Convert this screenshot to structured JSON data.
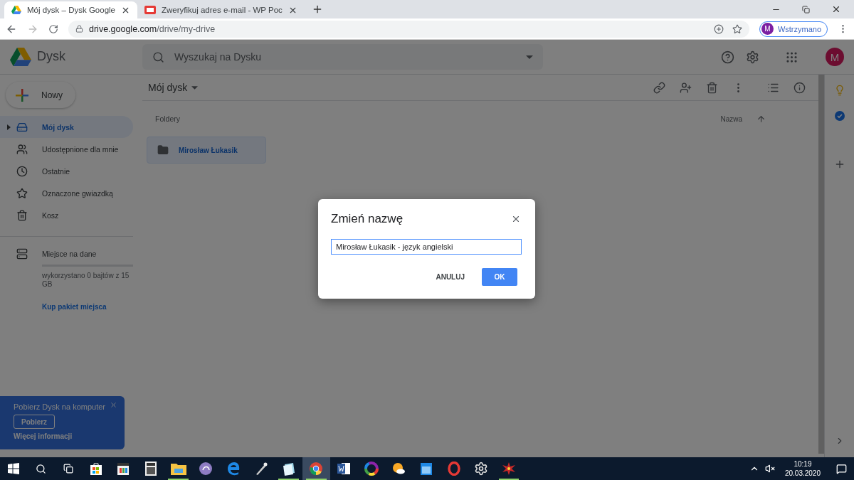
{
  "browser": {
    "tabs": [
      {
        "title": "Mój dysk – Dysk Google",
        "selected": true,
        "kind": "drive"
      },
      {
        "title": "Zweryfikuj adres e-mail - WP Poc",
        "selected": false,
        "kind": "wp"
      }
    ],
    "url_host": "drive.google.com",
    "url_path": "/drive/my-drive",
    "profile": {
      "initial": "M",
      "status": "Wstrzymano"
    }
  },
  "drive": {
    "product": "Dysk",
    "search_placeholder": "Wyszukaj na Dysku",
    "account_initial": "M",
    "new_button": "Nowy",
    "nav": [
      {
        "label": "Mój dysk",
        "kind": "mydrive",
        "selected": true
      },
      {
        "label": "Udostępnione dla mnie",
        "kind": "shared",
        "selected": false
      },
      {
        "label": "Ostatnie",
        "kind": "recent",
        "selected": false
      },
      {
        "label": "Oznaczone gwiazdką",
        "kind": "starred",
        "selected": false
      },
      {
        "label": "Kosz",
        "kind": "trash",
        "selected": false
      }
    ],
    "storage": {
      "label": "Miejsce na dane",
      "level": 0,
      "usage": "wykorzystano 0 bajtów z 15 GB",
      "link": "Kup pakiet miejsca"
    },
    "breadcrumb": "Mój dysk",
    "section": "Foldery",
    "sort": "Nazwa",
    "folders": [
      {
        "name": "Mirosław Łukasik",
        "selected": true
      }
    ]
  },
  "promo": {
    "title": "Pobierz Dysk na komputer",
    "button": "Pobierz",
    "link": "Więcej informacji"
  },
  "dialog": {
    "title": "Zmień nazwę",
    "value": "Mirosław Łukasik - język angielski",
    "buttons": [
      {
        "label": "ANULUJ",
        "kind": "text"
      },
      {
        "label": "OK",
        "kind": "primary"
      }
    ]
  },
  "taskbar": {
    "apps": [
      {
        "kind": "store",
        "running": false,
        "selected": false
      },
      {
        "kind": "clapper",
        "running": false,
        "selected": false
      },
      {
        "kind": "calculator",
        "running": false,
        "selected": false
      },
      {
        "kind": "explorer",
        "running": true,
        "selected": false
      },
      {
        "kind": "torrent",
        "running": false,
        "selected": false
      },
      {
        "kind": "edge",
        "running": false,
        "selected": false
      },
      {
        "kind": "pen",
        "running": false,
        "selected": false
      },
      {
        "kind": "notepad",
        "running": true,
        "selected": false
      },
      {
        "kind": "chrome",
        "running": true,
        "selected": true
      },
      {
        "kind": "word",
        "running": false,
        "selected": false
      },
      {
        "kind": "wheel",
        "running": false,
        "selected": false
      },
      {
        "kind": "weather",
        "running": false,
        "selected": false
      },
      {
        "kind": "calendar",
        "running": false,
        "selected": false
      },
      {
        "kind": "opera",
        "running": false,
        "selected": false
      },
      {
        "kind": "gears",
        "running": false,
        "selected": false
      },
      {
        "kind": "burst",
        "running": true,
        "selected": false
      }
    ],
    "time": "10:19",
    "date": "20.03.2020"
  }
}
